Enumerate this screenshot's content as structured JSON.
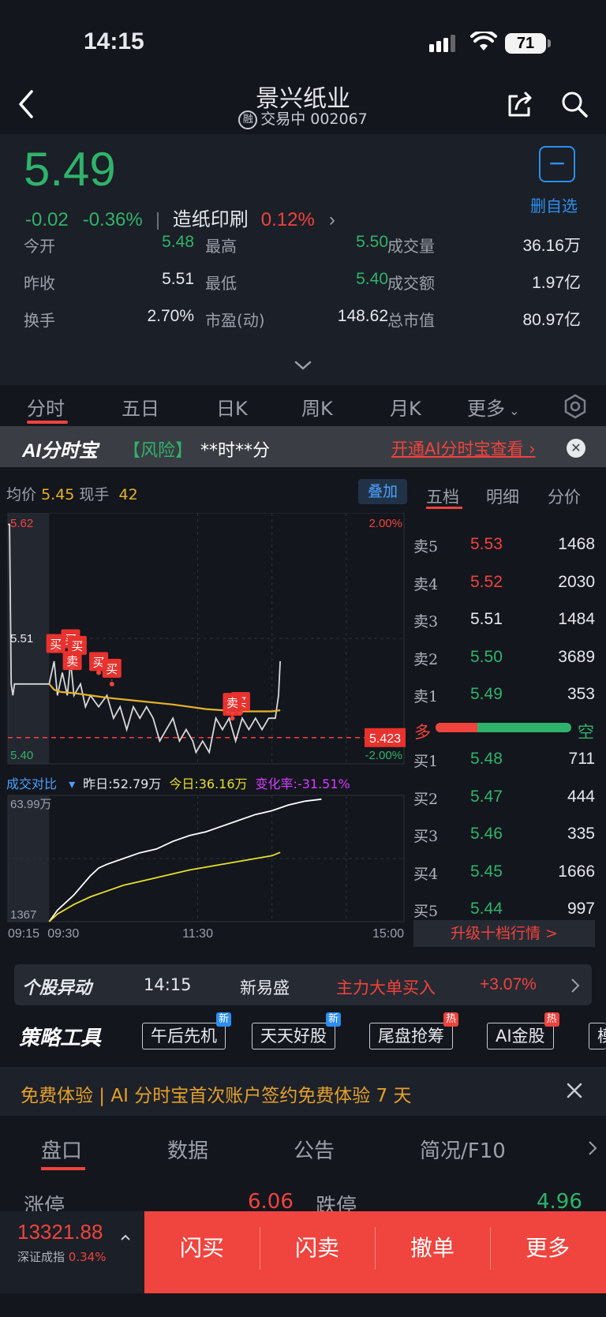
{
  "status_bar": {
    "time": "14:15",
    "battery": "71"
  },
  "header": {
    "title": "景兴纸业",
    "rong": "融",
    "subtitle": "交易中 002067"
  },
  "quote": {
    "price": "5.49",
    "change": "-0.02",
    "change_pct": "-0.36%",
    "sector": "造纸印刷",
    "sector_pct": "0.12%",
    "remove_watch": "删自选",
    "stats": [
      {
        "label": "今开",
        "value": "5.48",
        "color": "green"
      },
      {
        "label": "最高",
        "value": "5.50",
        "color": "green"
      },
      {
        "label": "成交量",
        "value": "36.16万",
        "color": "white"
      },
      {
        "label": "昨收",
        "value": "5.51",
        "color": "white"
      },
      {
        "label": "最低",
        "value": "5.40",
        "color": "green"
      },
      {
        "label": "成交额",
        "value": "1.97亿",
        "color": "white"
      },
      {
        "label": "换手",
        "value": "2.70%",
        "color": "white"
      },
      {
        "label": "市盈(动)",
        "value": "148.62",
        "color": "white"
      },
      {
        "label": "总市值",
        "value": "80.97亿",
        "color": "white"
      }
    ]
  },
  "chart_tabs": [
    "分时",
    "五日",
    "日K",
    "周K",
    "月K",
    "更多"
  ],
  "ai_banner": {
    "logo": "AI分时宝",
    "risk": "【风险】",
    "time": "**时**分",
    "link": "开通AI分时宝查看"
  },
  "chart_header": {
    "avg_label": "均价",
    "avg_value": "5.45",
    "now_label": "现手",
    "now_value": "42",
    "overlay": "叠加"
  },
  "chart_data": [
    {
      "type": "line",
      "xlabel": "",
      "ylabel": "",
      "x_ticks": [
        "09:15",
        "09:30",
        "11:30",
        "15:00"
      ],
      "y_left_ticks": [
        "5.62",
        "5.51",
        "5.40"
      ],
      "y_right_ticks": [
        "2.00%",
        "-2.00%"
      ],
      "ylim": [
        5.4,
        5.62
      ],
      "reference_line": 5.423,
      "reference_label": "5.423",
      "series": [
        {
          "name": "price",
          "color": "#d8d8d8",
          "points": [
            [
              0,
              5.61
            ],
            [
              1,
              5.61
            ],
            [
              2,
              5.47
            ],
            [
              3,
              5.46
            ],
            [
              4,
              5.47
            ],
            [
              10,
              5.47
            ],
            [
              20,
              5.47
            ],
            [
              25,
              5.47
            ],
            [
              28,
              5.49
            ],
            [
              30,
              5.46
            ],
            [
              33,
              5.48
            ],
            [
              36,
              5.46
            ],
            [
              38,
              5.49
            ],
            [
              40,
              5.46
            ],
            [
              44,
              5.47
            ],
            [
              47,
              5.45
            ],
            [
              50,
              5.46
            ],
            [
              55,
              5.45
            ],
            [
              60,
              5.46
            ],
            [
              64,
              5.44
            ],
            [
              68,
              5.45
            ],
            [
              72,
              5.43
            ],
            [
              76,
              5.45
            ],
            [
              80,
              5.44
            ],
            [
              84,
              5.45
            ],
            [
              88,
              5.44
            ],
            [
              92,
              5.42
            ],
            [
              96,
              5.43
            ],
            [
              100,
              5.44
            ],
            [
              104,
              5.42
            ],
            [
              108,
              5.43
            ],
            [
              112,
              5.42
            ],
            [
              114,
              5.41
            ],
            [
              118,
              5.42
            ],
            [
              122,
              5.41
            ],
            [
              126,
              5.44
            ],
            [
              130,
              5.43
            ],
            [
              134,
              5.44
            ],
            [
              138,
              5.42
            ],
            [
              142,
              5.44
            ],
            [
              146,
              5.43
            ],
            [
              150,
              5.44
            ],
            [
              154,
              5.43
            ],
            [
              158,
              5.44
            ],
            [
              162,
              5.44
            ],
            [
              164,
              5.46
            ],
            [
              165,
              5.49
            ]
          ]
        },
        {
          "name": "avg",
          "color": "#e5b32a",
          "points": [
            [
              25,
              5.47
            ],
            [
              28,
              5.465
            ],
            [
              32,
              5.463
            ],
            [
              40,
              5.462
            ],
            [
              60,
              5.458
            ],
            [
              80,
              5.455
            ],
            [
              100,
              5.452
            ],
            [
              120,
              5.448
            ],
            [
              140,
              5.446
            ],
            [
              160,
              5.446
            ],
            [
              165,
              5.447
            ]
          ]
        }
      ],
      "annotations": [
        {
          "label": "买",
          "x": 29,
          "y": 5.5
        },
        {
          "label": "买",
          "x": 38,
          "y": 5.5
        },
        {
          "label": "买",
          "x": 42,
          "y": 5.49
        },
        {
          "label": "卖",
          "x": 39,
          "y": 5.485
        },
        {
          "label": "买",
          "x": 55,
          "y": 5.48
        },
        {
          "label": "买",
          "x": 63,
          "y": 5.47
        },
        {
          "label": "买",
          "x": 136,
          "y": 5.445
        },
        {
          "label": "买",
          "x": 141,
          "y": 5.445
        },
        {
          "label": "卖",
          "x": 136,
          "y": 5.44
        }
      ]
    },
    {
      "type": "line",
      "y_ticks": [
        "63.99万",
        "1367"
      ],
      "series": [
        {
          "name": "昨日",
          "color": "#ffffff",
          "points": [
            [
              25,
              0
            ],
            [
              30,
              6
            ],
            [
              40,
              14
            ],
            [
              50,
              24
            ],
            [
              55,
              28
            ],
            [
              60,
              30
            ],
            [
              70,
              33
            ],
            [
              80,
              36
            ],
            [
              90,
              38
            ],
            [
              100,
              42
            ],
            [
              110,
              45
            ],
            [
              120,
              47
            ],
            [
              130,
              50
            ],
            [
              140,
              53
            ],
            [
              150,
              56
            ],
            [
              160,
              58
            ],
            [
              170,
              61
            ],
            [
              180,
              63
            ],
            [
              190,
              64
            ]
          ]
        },
        {
          "name": "今日",
          "color": "#e6e02a",
          "points": [
            [
              25,
              0
            ],
            [
              30,
              4
            ],
            [
              40,
              9
            ],
            [
              50,
              13
            ],
            [
              60,
              16
            ],
            [
              70,
              19
            ],
            [
              80,
              21
            ],
            [
              90,
              23
            ],
            [
              100,
              25
            ],
            [
              110,
              27
            ],
            [
              120,
              28.5
            ],
            [
              130,
              30
            ],
            [
              140,
              31.5
            ],
            [
              150,
              33
            ],
            [
              160,
              34.5
            ],
            [
              165,
              36.2
            ]
          ]
        }
      ]
    }
  ],
  "volume_compare": {
    "label": "成交对比",
    "yesterday": "昨日:52.79万",
    "today": "今日:36.16万",
    "change": "变化率:-31.51%"
  },
  "orderbook": {
    "tabs": [
      "五档",
      "明细",
      "分价"
    ],
    "asks": [
      {
        "label": "卖5",
        "price": "5.53",
        "vol": "1468",
        "color": "red"
      },
      {
        "label": "卖4",
        "price": "5.52",
        "vol": "2030",
        "color": "red"
      },
      {
        "label": "卖3",
        "price": "5.51",
        "vol": "1484",
        "color": "white"
      },
      {
        "label": "卖2",
        "price": "5.50",
        "vol": "3689",
        "color": "green"
      },
      {
        "label": "卖1",
        "price": "5.49",
        "vol": "353",
        "color": "green"
      }
    ],
    "long": "多",
    "short": "空",
    "long_ratio": 0.31,
    "bids": [
      {
        "label": "买1",
        "price": "5.48",
        "vol": "711",
        "color": "green"
      },
      {
        "label": "买2",
        "price": "5.47",
        "vol": "444",
        "color": "green"
      },
      {
        "label": "买3",
        "price": "5.46",
        "vol": "335",
        "color": "green"
      },
      {
        "label": "买4",
        "price": "5.45",
        "vol": "1666",
        "color": "green"
      },
      {
        "label": "买5",
        "price": "5.44",
        "vol": "997",
        "color": "green"
      }
    ],
    "upgrade": "升级十档行情 >"
  },
  "movement": {
    "title": "个股异动",
    "time": "14:15",
    "name": "新易盛",
    "event": "主力大单买入",
    "pct": "+3.07%"
  },
  "strategy": {
    "title": "策略工具",
    "tools": [
      {
        "label": "午后先机",
        "badge": "新",
        "badge_color": "#2b8ff0"
      },
      {
        "label": "天天好股",
        "badge": "新",
        "badge_color": "#2b8ff0"
      },
      {
        "label": "尾盘抢筹",
        "badge": "热",
        "badge_color": "#f0433d"
      },
      {
        "label": "AI金股",
        "badge": "热",
        "badge_color": "#f0433d"
      },
      {
        "label": "模拟",
        "badge": "",
        "badge_color": ""
      }
    ]
  },
  "trial": {
    "text": "免费体验 | AI 分时宝首次账户签约免费体验 7 天"
  },
  "bottom_tabs": [
    "盘口",
    "数据",
    "公告",
    "简况/F10"
  ],
  "limits": {
    "up_label": "涨停",
    "up_value": "6.06",
    "down_label": "跌停",
    "down_value": "4.96"
  },
  "index": {
    "value": "13321.88",
    "name": "深证成指",
    "pct": "0.34%"
  },
  "actions": [
    "闪买",
    "闪卖",
    "撤单",
    "更多"
  ]
}
